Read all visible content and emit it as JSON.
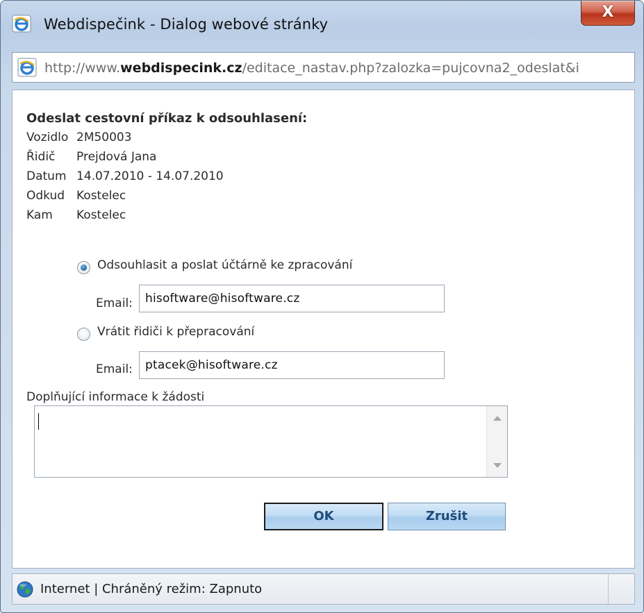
{
  "window": {
    "title": "Webdispečink - Dialog webové stránky",
    "close_label": "X"
  },
  "address": {
    "prefix": "http://www.",
    "domain": "webdispecink.cz",
    "path": "/editace_nastav.php?zalozka=pujcovna2_odeslat&i"
  },
  "form": {
    "heading": "Odeslat cestovní příkaz k odsouhlasení:",
    "info": [
      {
        "label": "Vozidlo",
        "value": "2M50003"
      },
      {
        "label": "Řidič",
        "value": "Prejdová Jana"
      },
      {
        "label": "Datum",
        "value": "14.07.2010 - 14.07.2010"
      },
      {
        "label": "Odkud",
        "value": "Kostelec"
      },
      {
        "label": "Kam",
        "value": "Kostelec"
      }
    ],
    "option_approve": {
      "label": "Odsouhlasit a poslat účtárně ke zpracování",
      "email_label": "Email:",
      "email_value": "hisoftware@hisoftware.cz",
      "selected": true
    },
    "option_return": {
      "label": "Vrátit řidiči k přepracování",
      "email_label": "Email:",
      "email_value": "ptacek@hisoftware.cz",
      "selected": false
    },
    "notes_label": "Doplňující informace k žádosti",
    "notes_value": "",
    "ok_label": "OK",
    "cancel_label": "Zrušit"
  },
  "status": {
    "text": "Internet | Chráněný režim: Zapnuto"
  },
  "colors": {
    "frame": "#c7d8ec",
    "close_button": "#c8442c",
    "button_text": "#1f4d7a"
  },
  "icons": {
    "title": "ie-icon",
    "address": "ie-page-icon",
    "status": "globe-icon"
  }
}
